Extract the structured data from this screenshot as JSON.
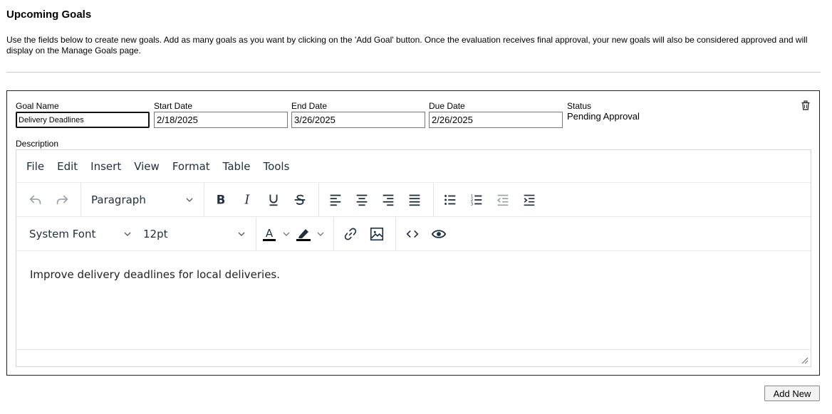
{
  "section": {
    "title": "Upcoming Goals",
    "instructions": "Use the fields below to create new goals. Add as many goals as you want by clicking on the 'Add Goal' button. Once the evaluation receives final approval, your new goals will also be considered approved and will display on the Manage Goals page."
  },
  "goal": {
    "name_label": "Goal Name",
    "name_value": "Delivery Deadlines",
    "start_label": "Start Date",
    "start_value": "2/18/2025",
    "end_label": "End Date",
    "end_value": "3/26/2025",
    "due_label": "Due Date",
    "due_value": "2/26/2025",
    "status_label": "Status",
    "status_value": "Pending Approval",
    "delete_icon": "trash-icon",
    "description_label": "Description"
  },
  "editor": {
    "menu": [
      "File",
      "Edit",
      "Insert",
      "View",
      "Format",
      "Table",
      "Tools"
    ],
    "block_format": "Paragraph",
    "font_family": "System Font",
    "font_size": "12pt",
    "content": "Improve delivery deadlines for local deliveries.",
    "text_color": "#000000",
    "highlight_color": "#000000"
  },
  "actions": {
    "add_new_label": "Add New"
  }
}
